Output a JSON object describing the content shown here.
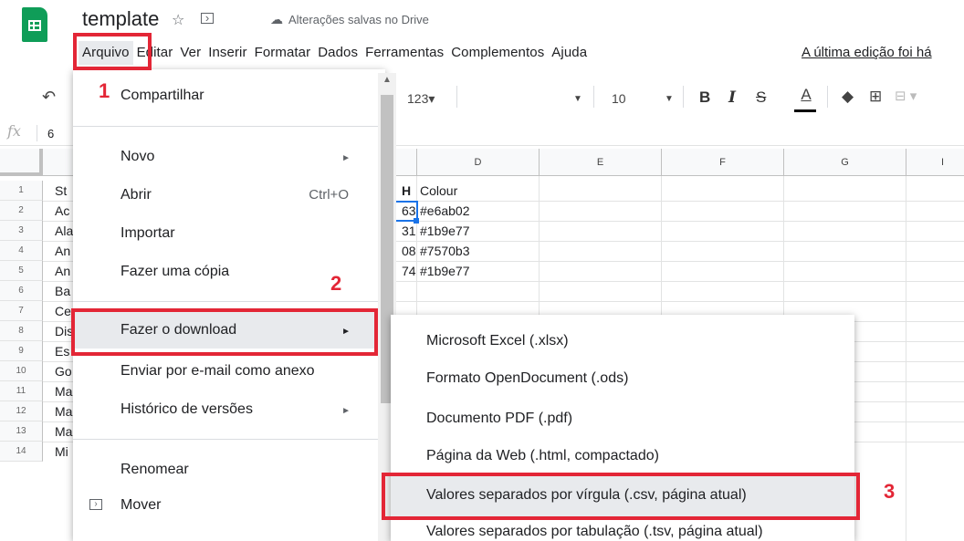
{
  "header": {
    "title": "template",
    "saved_status": "Alterações salvas no Drive",
    "last_edit": "A última edição foi há"
  },
  "menubar": [
    "Arquivo",
    "Editar",
    "Ver",
    "Inserir",
    "Formatar",
    "Dados",
    "Ferramentas",
    "Complementos",
    "Ajuda"
  ],
  "toolbar": {
    "format_num": "123",
    "font_size": "10",
    "bold": "B",
    "italic": "I",
    "strike": "S",
    "text_color": "A"
  },
  "formula_bar": {
    "fx": "fx",
    "value": "6"
  },
  "columns": [
    "D",
    "E",
    "F",
    "G",
    "I"
  ],
  "rows": [
    "1",
    "2",
    "3",
    "4",
    "5",
    "6",
    "7",
    "8",
    "9",
    "10",
    "11",
    "12",
    "13",
    "14"
  ],
  "col_a_partial": [
    "St",
    "Ac",
    "Ala",
    "An",
    "An",
    "Ba",
    "Ce",
    "Dis",
    "Es",
    "Go",
    "Ma",
    "Ma",
    "Ma",
    "Mi"
  ],
  "col_c_partial": [
    "H",
    "63",
    "31",
    "08",
    "74"
  ],
  "col_d": [
    "Colour",
    "#e6ab02",
    "#1b9e77",
    "#7570b3",
    "#1b9e77"
  ],
  "file_menu": {
    "share": "Compartilhar",
    "new": "Novo",
    "open": "Abrir",
    "open_shortcut": "Ctrl+O",
    "import": "Importar",
    "copy": "Fazer uma cópia",
    "download": "Fazer o download",
    "email": "Enviar por e-mail como anexo",
    "history": "Histórico de versões",
    "rename": "Renomear",
    "move": "Mover"
  },
  "download_menu": [
    "Microsoft Excel (.xlsx)",
    "Formato OpenDocument (.ods)",
    "Documento PDF (.pdf)",
    "Página da Web (.html, compactado)",
    "Valores separados por vírgula (.csv, página atual)",
    "Valores separados por tabulação (.tsv, página atual)"
  ],
  "annotations": [
    "1",
    "2",
    "3"
  ],
  "colors": {
    "accent_red": "#e32636",
    "sheets_green": "#0f9d58"
  }
}
